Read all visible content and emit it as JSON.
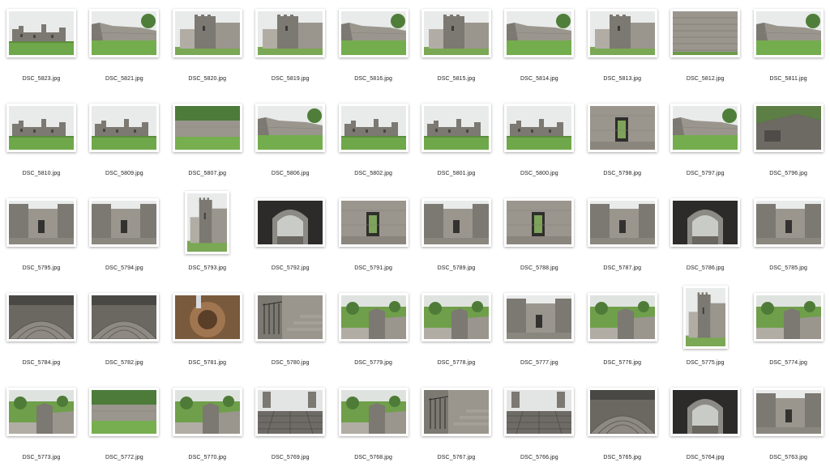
{
  "colors": {
    "background": "#ffffff",
    "text": "#222222",
    "sky": "#e8eaea",
    "grass": "#6fa54a",
    "stone": "#8d8a84",
    "dark": "#3a3937"
  },
  "files": [
    {
      "name": "DSC_5823.jpg",
      "scene": "castle-wide"
    },
    {
      "name": "DSC_5821.jpg",
      "scene": "wall-grass"
    },
    {
      "name": "DSC_5820.jpg",
      "scene": "tower-corner"
    },
    {
      "name": "DSC_5819.jpg",
      "scene": "tower-corner"
    },
    {
      "name": "DSC_5816.jpg",
      "scene": "wall-grass"
    },
    {
      "name": "DSC_5815.jpg",
      "scene": "tower-corner"
    },
    {
      "name": "DSC_5814.jpg",
      "scene": "wall-grass"
    },
    {
      "name": "DSC_5813.jpg",
      "scene": "tower-corner"
    },
    {
      "name": "DSC_5812.jpg",
      "scene": "stone-wall"
    },
    {
      "name": "DSC_5811.jpg",
      "scene": "wall-grass"
    },
    {
      "name": "DSC_5810.jpg",
      "scene": "castle-wide"
    },
    {
      "name": "DSC_5809.jpg",
      "scene": "castle-wide"
    },
    {
      "name": "DSC_5807.jpg",
      "scene": "wall-trees"
    },
    {
      "name": "DSC_5806.jpg",
      "scene": "wall-grass"
    },
    {
      "name": "DSC_5802.jpg",
      "scene": "castle-wide"
    },
    {
      "name": "DSC_5801.jpg",
      "scene": "castle-wide"
    },
    {
      "name": "DSC_5800.jpg",
      "scene": "castle-wide"
    },
    {
      "name": "DSC_5798.jpg",
      "scene": "doorway"
    },
    {
      "name": "DSC_5797.jpg",
      "scene": "wall-grass"
    },
    {
      "name": "DSC_5796.jpg",
      "scene": "interior-dark"
    },
    {
      "name": "DSC_5795.jpg",
      "scene": "courtyard"
    },
    {
      "name": "DSC_5794.jpg",
      "scene": "courtyard"
    },
    {
      "name": "DSC_5793.jpg",
      "scene": "tower-corner",
      "portrait": true
    },
    {
      "name": "DSC_5792.jpg",
      "scene": "arch-dark"
    },
    {
      "name": "DSC_5791.jpg",
      "scene": "doorway"
    },
    {
      "name": "DSC_5789.jpg",
      "scene": "courtyard"
    },
    {
      "name": "DSC_5788.jpg",
      "scene": "doorway"
    },
    {
      "name": "DSC_5787.jpg",
      "scene": "courtyard"
    },
    {
      "name": "DSC_5786.jpg",
      "scene": "arch-dark"
    },
    {
      "name": "DSC_5785.jpg",
      "scene": "courtyard"
    },
    {
      "name": "DSC_5784.jpg",
      "scene": "stair-spiral"
    },
    {
      "name": "DSC_5782.jpg",
      "scene": "stair-spiral"
    },
    {
      "name": "DSC_5781.jpg",
      "scene": "stair-warm"
    },
    {
      "name": "DSC_5780.jpg",
      "scene": "stair-rail"
    },
    {
      "name": "DSC_5779.jpg",
      "scene": "ruin-view"
    },
    {
      "name": "DSC_5778.jpg",
      "scene": "ruin-view"
    },
    {
      "name": "DSC_5777.jpg",
      "scene": "courtyard"
    },
    {
      "name": "DSC_5776.jpg",
      "scene": "ruin-view"
    },
    {
      "name": "DSC_5775.jpg",
      "scene": "tower-corner",
      "portrait": true
    },
    {
      "name": "DSC_5774.jpg",
      "scene": "ruin-view"
    },
    {
      "name": "DSC_5773.jpg",
      "scene": "ruin-view"
    },
    {
      "name": "DSC_5772.jpg",
      "scene": "wall-trees"
    },
    {
      "name": "DSC_5770.jpg",
      "scene": "ruin-view"
    },
    {
      "name": "DSC_5769.jpg",
      "scene": "roof-slabs"
    },
    {
      "name": "DSC_5768.jpg",
      "scene": "ruin-view"
    },
    {
      "name": "DSC_5767.jpg",
      "scene": "stair-rail"
    },
    {
      "name": "DSC_5766.jpg",
      "scene": "roof-slabs"
    },
    {
      "name": "DSC_5765.jpg",
      "scene": "stair-spiral"
    },
    {
      "name": "DSC_5764.jpg",
      "scene": "arch-dark"
    },
    {
      "name": "DSC_5763.jpg",
      "scene": "courtyard"
    }
  ]
}
